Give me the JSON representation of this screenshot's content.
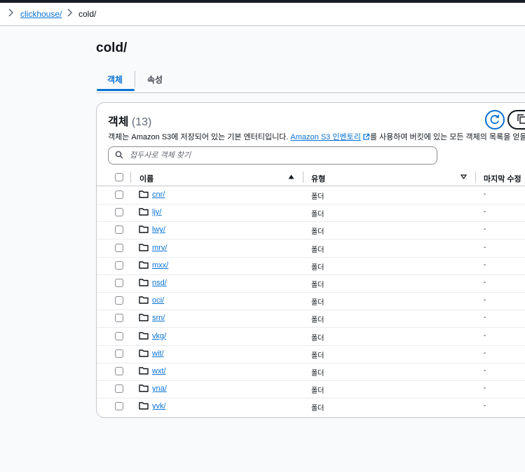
{
  "breadcrumb": {
    "items": [
      {
        "label": "/",
        "link": true
      },
      {
        "label": "clickhouse/",
        "link": true
      },
      {
        "label": "cold/",
        "link": false
      }
    ]
  },
  "page": {
    "title": "cold/"
  },
  "tabs": [
    {
      "label": "객체",
      "active": true
    },
    {
      "label": "속성",
      "active": false
    }
  ],
  "objects_panel": {
    "heading": "객체",
    "count": "(13)",
    "description_before": "객체는 Amazon S3에 저장되어 있는 기본 엔터티입니다. ",
    "inventory_link": "Amazon S3 인벤토리",
    "description_after": "를 사용하여 버킷에 있는 모든 객체의 목록을 얻을 수",
    "search_placeholder": "접두사로 객체 찾기",
    "columns": {
      "name": "이름",
      "type": "유형",
      "modified": "마지막 수정"
    },
    "rows": [
      {
        "name": "cnr/",
        "type": "폴더",
        "modified": "-"
      },
      {
        "name": "ljy/",
        "type": "폴더",
        "modified": "-"
      },
      {
        "name": "lwy/",
        "type": "폴더",
        "modified": "-"
      },
      {
        "name": "mry/",
        "type": "폴더",
        "modified": "-"
      },
      {
        "name": "mxx/",
        "type": "폴더",
        "modified": "-"
      },
      {
        "name": "nsd/",
        "type": "폴더",
        "modified": "-"
      },
      {
        "name": "oci/",
        "type": "폴더",
        "modified": "-"
      },
      {
        "name": "srn/",
        "type": "폴더",
        "modified": "-"
      },
      {
        "name": "vkg/",
        "type": "폴더",
        "modified": "-"
      },
      {
        "name": "wit/",
        "type": "폴더",
        "modified": "-"
      },
      {
        "name": "wxt/",
        "type": "폴더",
        "modified": "-"
      },
      {
        "name": "yna/",
        "type": "폴더",
        "modified": "-"
      },
      {
        "name": "yvk/",
        "type": "폴더",
        "modified": "-"
      }
    ]
  },
  "colors": {
    "link": "#0972d3",
    "text": "#0f141a",
    "border": "#c6c6cd",
    "background": "#f9fafb"
  },
  "icons": [
    "chevron-right-icon",
    "refresh-icon",
    "copy-icon",
    "external-link-icon",
    "search-icon",
    "sort-ascending-icon",
    "sort-descending-icon",
    "folder-icon"
  ]
}
